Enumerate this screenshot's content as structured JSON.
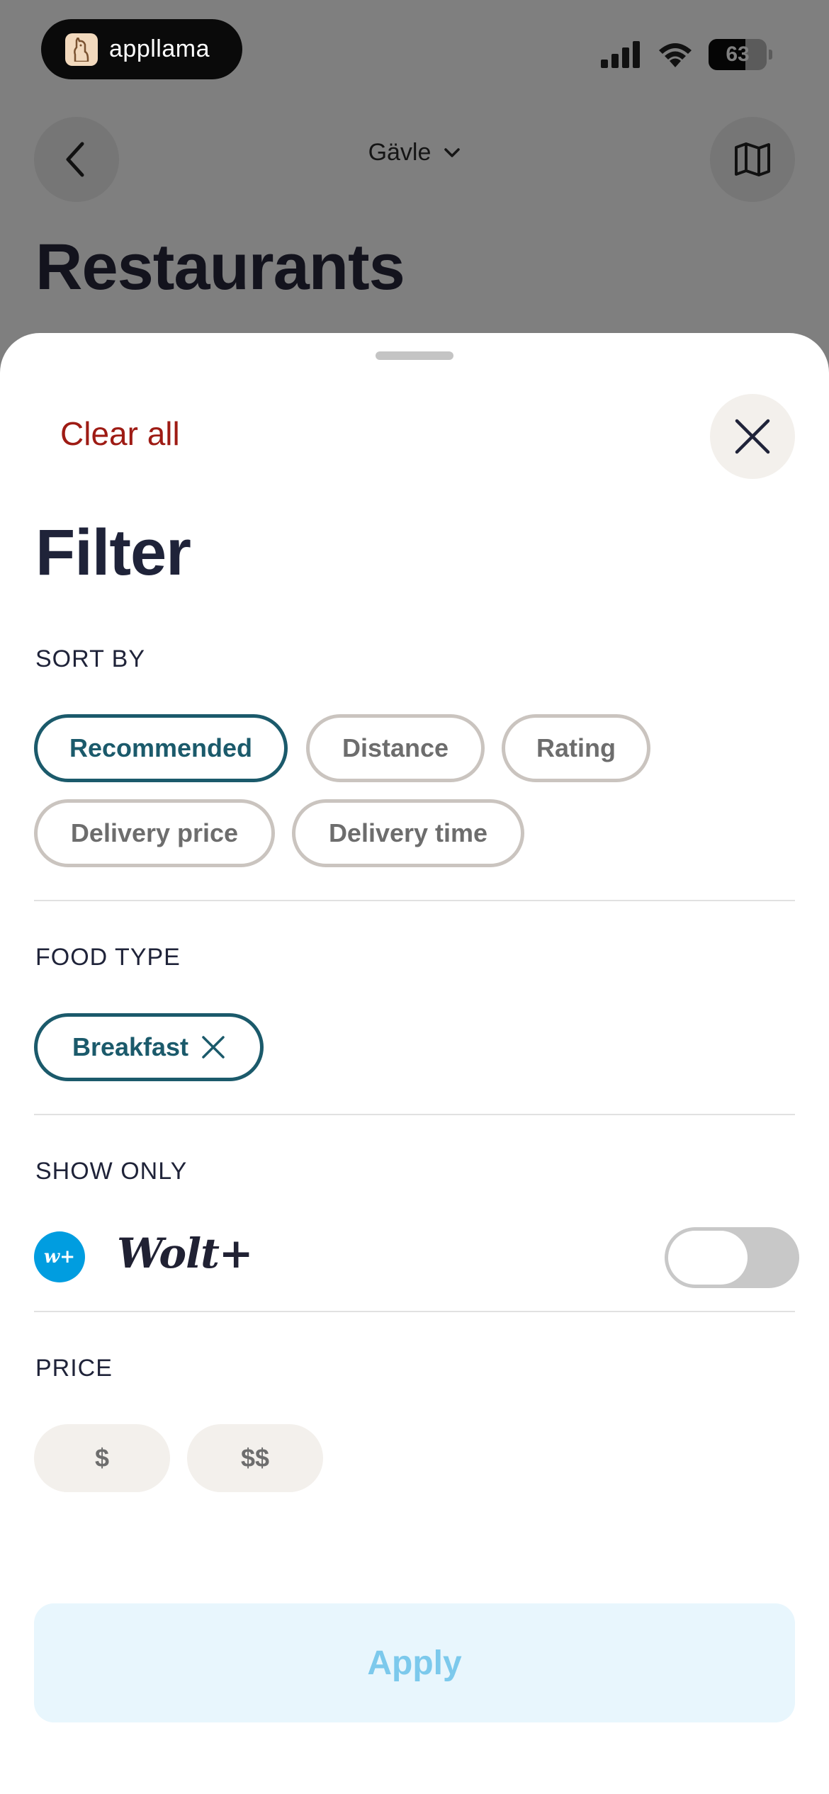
{
  "status_bar": {
    "app_name": "appllama",
    "battery": "63",
    "icons": [
      "llama-logo-icon",
      "cellular-signal-icon",
      "wifi-icon",
      "battery-icon"
    ]
  },
  "background": {
    "city": "Gävle",
    "title": "Restaurants",
    "icons": [
      "back-chevron-icon",
      "chevron-down-icon",
      "map-icon"
    ]
  },
  "sheet": {
    "clear_all": "Clear all",
    "title": "Filter",
    "sort_by": {
      "label": "SORT BY",
      "options": [
        "Recommended",
        "Distance",
        "Rating",
        "Delivery price",
        "Delivery time"
      ],
      "selected": "Recommended"
    },
    "food_type": {
      "label": "FOOD TYPE",
      "chips": [
        "Breakfast"
      ]
    },
    "show_only": {
      "label": "SHOW ONLY",
      "badge": "w+",
      "logo": "Wolt+",
      "toggle_on": false
    },
    "price": {
      "label": "PRICE",
      "options": [
        "$",
        "$$"
      ]
    },
    "apply": "Apply"
  },
  "colors": {
    "accent": "#1b5a6b",
    "clear_all": "#9e1b14",
    "wolt_blue": "#009de0",
    "apply_bg": "#e8f6fd",
    "apply_text": "#7cc9ec"
  }
}
